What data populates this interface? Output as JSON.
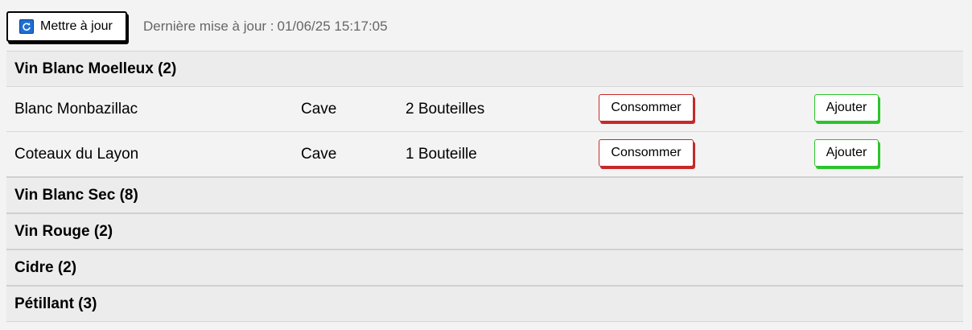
{
  "toolbar": {
    "refresh_label": "Mettre à jour",
    "last_update_label": "Dernière mise à jour :",
    "last_update_value": "01/06/25 15:17:05"
  },
  "colors": {
    "consume_accent": "#c62828",
    "add_accent": "#2bc42b",
    "refresh_icon": "#1f6fd1"
  },
  "categories": [
    {
      "title": "Vin Blanc Moelleux (2)",
      "expanded": true,
      "wines": [
        {
          "name": "Blanc Monbazillac",
          "location": "Cave",
          "quantity": "2 Bouteilles",
          "consume_label": "Consommer",
          "add_label": "Ajouter"
        },
        {
          "name": "Coteaux du Layon",
          "location": "Cave",
          "quantity": "1 Bouteille",
          "consume_label": "Consommer",
          "add_label": "Ajouter"
        }
      ]
    },
    {
      "title": "Vin Blanc Sec (8)",
      "expanded": false
    },
    {
      "title": "Vin Rouge (2)",
      "expanded": false
    },
    {
      "title": "Cidre (2)",
      "expanded": false
    },
    {
      "title": "Pétillant (3)",
      "expanded": false
    }
  ]
}
